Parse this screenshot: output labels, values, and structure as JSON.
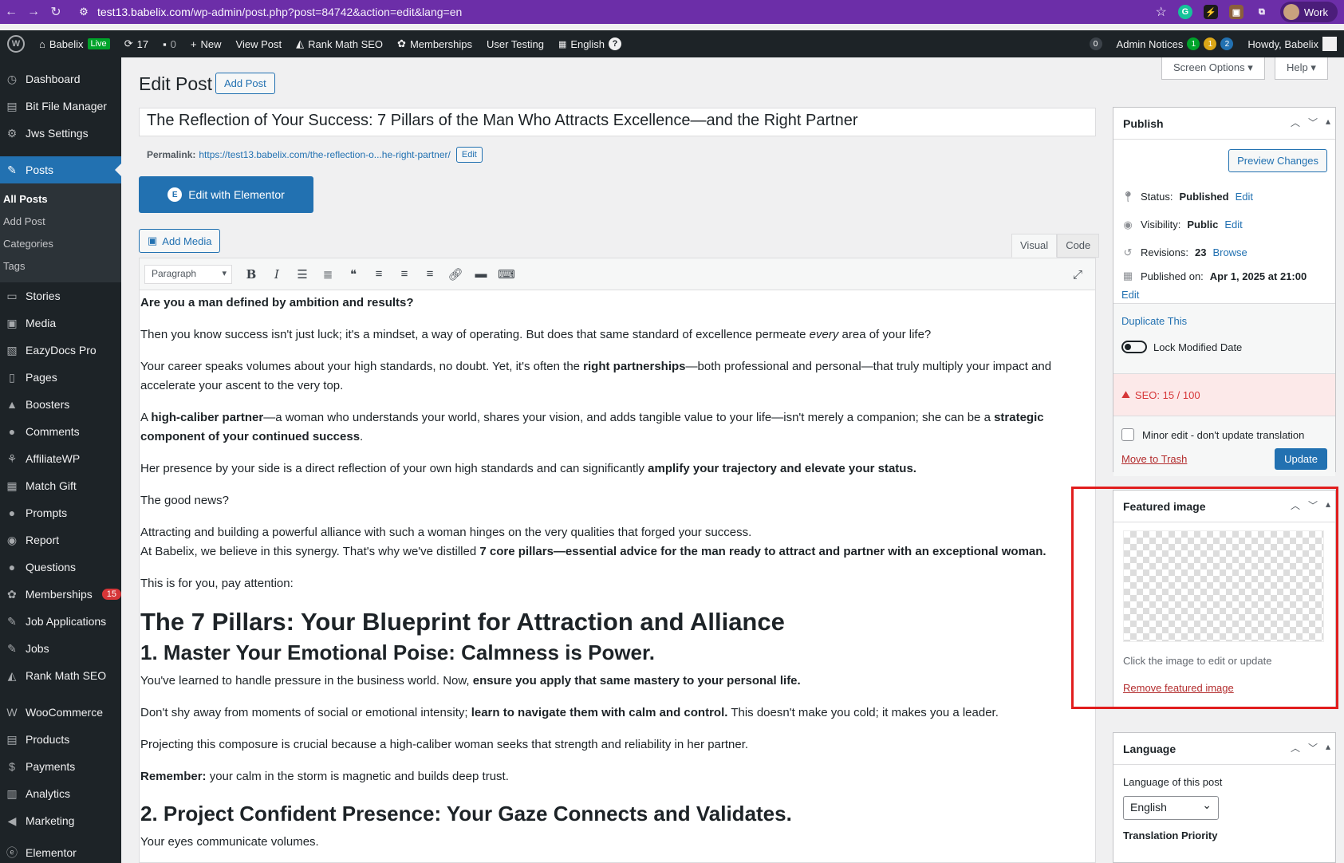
{
  "browser": {
    "url_host": "test13.babelix.com",
    "url_path": "/wp-admin/post.php?post=84742&action=edit&lang=en",
    "profile": "Work"
  },
  "adminbar": {
    "site": "Babelix",
    "live": "Live",
    "updates": "17",
    "comments": "0",
    "new": "New",
    "view_post": "View Post",
    "rank_math": "Rank Math SEO",
    "memberships": "Memberships",
    "user_testing": "User Testing",
    "language": "English",
    "notice_count": "0",
    "admin_notices": "Admin Notices",
    "notice_green": "1",
    "notice_yellow": "1",
    "notice_blue": "2",
    "howdy": "Howdy, Babelix"
  },
  "sidebar": {
    "items": [
      {
        "label": "Dashboard",
        "icon": "dashboard-icon"
      },
      {
        "label": "Bit File Manager",
        "icon": "folder-icon"
      },
      {
        "label": "Jws Settings",
        "icon": "gear-icon"
      },
      {
        "label": "Posts",
        "icon": "pin-icon"
      },
      {
        "label": "Stories",
        "icon": "stories-icon"
      },
      {
        "label": "Media",
        "icon": "media-icon"
      },
      {
        "label": "EazyDocs Pro",
        "icon": "docs-icon"
      },
      {
        "label": "Pages",
        "icon": "pages-icon"
      },
      {
        "label": "Boosters",
        "icon": "rocket-icon"
      },
      {
        "label": "Comments",
        "icon": "comment-icon"
      },
      {
        "label": "AffiliateWP",
        "icon": "affiliate-icon"
      },
      {
        "label": "Match Gift",
        "icon": "gift-icon"
      },
      {
        "label": "Prompts",
        "icon": "prompt-icon"
      },
      {
        "label": "Report",
        "icon": "report-icon"
      },
      {
        "label": "Questions",
        "icon": "question-icon"
      },
      {
        "label": "Memberships",
        "icon": "membership-icon",
        "badge": "15"
      },
      {
        "label": "Job Applications",
        "icon": "pin-icon"
      },
      {
        "label": "Jobs",
        "icon": "pin-icon"
      },
      {
        "label": "Rank Math SEO",
        "icon": "chart-icon"
      },
      {
        "label": "WooCommerce",
        "icon": "woo-icon"
      },
      {
        "label": "Products",
        "icon": "product-icon"
      },
      {
        "label": "Payments",
        "icon": "payment-icon"
      },
      {
        "label": "Analytics",
        "icon": "analytics-icon"
      },
      {
        "label": "Marketing",
        "icon": "megaphone-icon"
      },
      {
        "label": "Elementor",
        "icon": "elementor-icon"
      }
    ],
    "posts_sub": [
      "All Posts",
      "Add Post",
      "Categories",
      "Tags"
    ]
  },
  "header": {
    "title": "Edit Post",
    "add_post": "Add Post",
    "screen_options": "Screen Options ▾",
    "help": "Help ▾"
  },
  "post": {
    "title": "The Reflection of Your Success: 7 Pillars of the Man Who Attracts Excellence—and the Right Partner",
    "permalink_label": "Permalink:",
    "permalink_url": "https://test13.babelix.com/the-reflection-o...he-right-partner/",
    "permalink_edit": "Edit",
    "elementor": "Edit with Elementor",
    "add_media": "Add Media",
    "tab_visual": "Visual",
    "tab_code": "Code",
    "format": "Paragraph"
  },
  "content": {
    "p1": "Are you a man defined by ambition and results?",
    "p2a": "Then you know success isn't just luck; it's a mindset, a way of operating. But does that same standard of excellence permeate ",
    "p2em": "every",
    "p2b": " area of your life?",
    "p3a": "Your career speaks volumes about your high standards, no doubt. Yet, it's often the ",
    "p3b": "right partnerships",
    "p3c": "—both professional and personal—that truly multiply your impact and accelerate your ascent to the very top.",
    "p4a": "A ",
    "p4b": "high-caliber partner",
    "p4c": "—a woman who understands your world, shares your vision, and adds tangible value to your life—isn't merely a companion; she can be a ",
    "p4d": "strategic component of your continued success",
    "p4e": ".",
    "p5a": "Her presence by your side is a direct reflection of your own high standards and can significantly ",
    "p5b": "amplify your trajectory and elevate your status.",
    "p6": "The good news?",
    "p7a": "Attracting and building a powerful alliance with such a woman hinges on the very qualities that forged your success.",
    "p7b": "At Babelix, we believe in this synergy. That's why we've distilled ",
    "p7c": "7 core pillars—essential advice for the man ready to attract and partner with an exceptional woman.",
    "p8": "This is for you, pay attention:",
    "h1": "The 7 Pillars: Your Blueprint for Attraction and Alliance",
    "h2a": "1. Master Your Emotional Poise: Calmness is Power.",
    "p9a": "You've learned to handle pressure in the business world. Now, ",
    "p9b": "ensure you apply that same mastery to your personal life.",
    "p10a": "Don't shy away from moments of social or emotional intensity; ",
    "p10b": "learn to navigate them with calm and control.",
    "p10c": " This doesn't make you cold; it makes you a leader.",
    "p11": "Projecting this composure is crucial because a high-caliber woman seeks that strength and reliability in her partner.",
    "p12a": "Remember:",
    "p12b": " your calm in the storm is magnetic and builds deep trust.",
    "h2b": "2. Project Confident Presence: Your Gaze Connects and Validates.",
    "p13": "Your eyes communicate volumes."
  },
  "publish": {
    "title": "Publish",
    "preview": "Preview Changes",
    "status_label": "Status:",
    "status_value": "Published",
    "visibility_label": "Visibility:",
    "visibility_value": "Public",
    "revisions_label": "Revisions:",
    "revisions_value": "23",
    "browse": "Browse",
    "published_label": "Published on:",
    "published_value": "Apr 1, 2025 at 21:00",
    "edit": "Edit",
    "duplicate": "Duplicate This",
    "lock_modified": "Lock Modified Date",
    "seo": "SEO: 15 / 100",
    "minor_edit": "Minor edit - don't update translation",
    "trash": "Move to Trash",
    "update": "Update"
  },
  "featured": {
    "title": "Featured image",
    "hint": "Click the image to edit or update",
    "remove": "Remove featured image"
  },
  "language": {
    "title": "Language",
    "label": "Language of this post",
    "value": "English",
    "priority": "Translation Priority"
  }
}
